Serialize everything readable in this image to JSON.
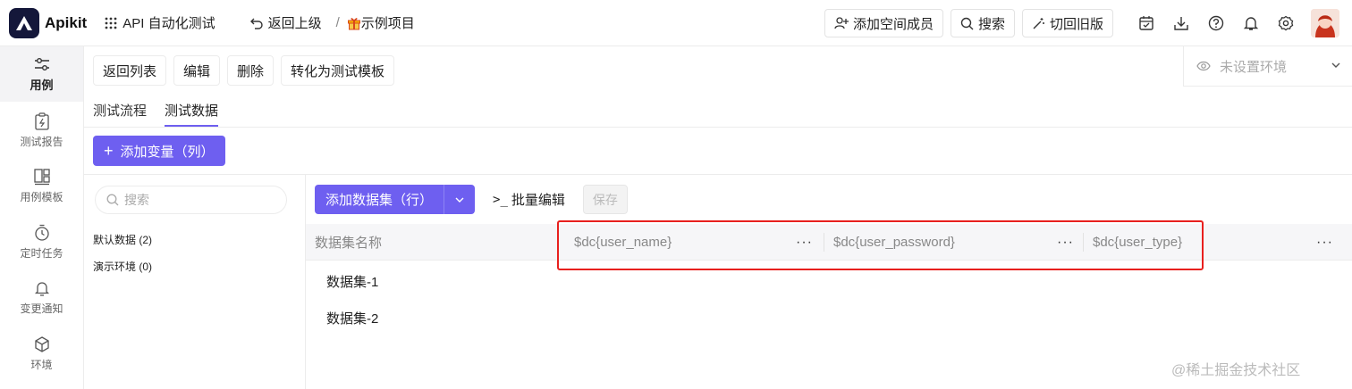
{
  "brand": {
    "name": "Apikit"
  },
  "header": {
    "workspace": "API 自动化测试",
    "back_up": "返回上级",
    "separator": "/",
    "project": "示例项目",
    "add_member": "添加空间成员",
    "search": "搜索",
    "switch_old": "切回旧版"
  },
  "sidebar": {
    "items": [
      {
        "label": "用例",
        "icon": "sliders-icon"
      },
      {
        "label": "测试报告",
        "icon": "report-icon"
      },
      {
        "label": "用例模板",
        "icon": "template-icon"
      },
      {
        "label": "定时任务",
        "icon": "timer-icon"
      },
      {
        "label": "变更通知",
        "icon": "bell-icon"
      },
      {
        "label": "环境",
        "icon": "cube-icon"
      }
    ]
  },
  "toolbar": {
    "back_list": "返回列表",
    "edit": "编辑",
    "delete": "删除",
    "convert": "转化为测试模板"
  },
  "env": {
    "placeholder": "未设置环境"
  },
  "tabs": [
    {
      "label": "测试流程"
    },
    {
      "label": "测试数据"
    }
  ],
  "add_variable": "添加变量（列）",
  "left_panel": {
    "search_placeholder": "搜索",
    "groups": [
      {
        "label": "默认数据 (2)"
      },
      {
        "label": "演示环境 (0)"
      }
    ]
  },
  "dataset_tools": {
    "add_dataset": "添加数据集（行）",
    "batch_edit": "批量编辑",
    "save": "保存"
  },
  "table": {
    "name_header": "数据集名称",
    "columns": [
      {
        "name": "$dc{user_name}"
      },
      {
        "name": "$dc{user_password}"
      },
      {
        "name": "$dc{user_type}"
      }
    ],
    "more": "···",
    "rows": [
      {
        "name": "数据集-1"
      },
      {
        "name": "数据集-2"
      }
    ]
  },
  "watermark": "@稀土掘金技术社区",
  "colors": {
    "accent": "#6e5ff0",
    "highlight": "#e8201e",
    "logo_bg": "#14173a"
  }
}
